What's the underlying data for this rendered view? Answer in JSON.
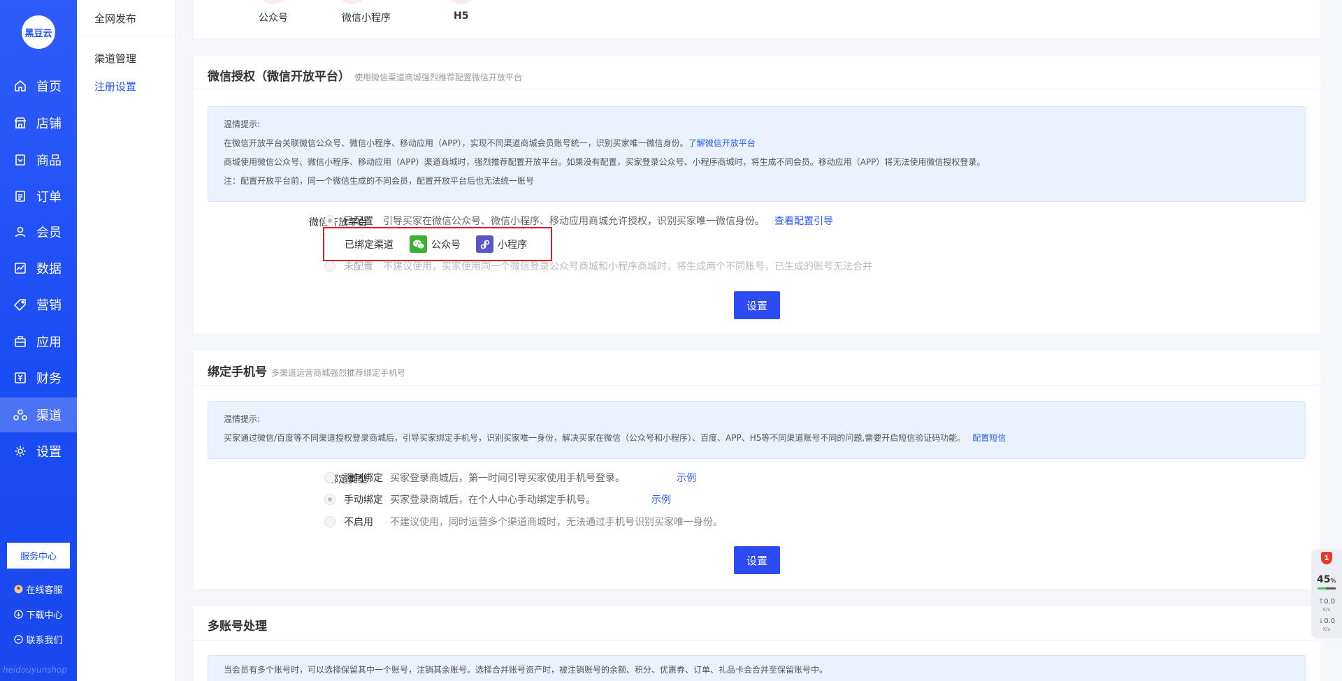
{
  "app": {
    "logo_text": "黑豆云",
    "watermark": "heidouyunshop"
  },
  "nav": {
    "items": [
      {
        "label": "首页",
        "icon": "home-icon"
      },
      {
        "label": "店铺",
        "icon": "store-icon"
      },
      {
        "label": "商品",
        "icon": "goods-icon"
      },
      {
        "label": "订单",
        "icon": "order-icon"
      },
      {
        "label": "会员",
        "icon": "member-icon"
      },
      {
        "label": "数据",
        "icon": "chart-icon"
      },
      {
        "label": "营销",
        "icon": "tag-icon"
      },
      {
        "label": "应用",
        "icon": "app-box-icon"
      },
      {
        "label": "财务",
        "icon": "finance-icon"
      },
      {
        "label": "渠道",
        "icon": "channel-icon"
      },
      {
        "label": "设置",
        "icon": "gear-icon"
      }
    ],
    "active": "渠道",
    "service_center": "服务中心",
    "links": [
      {
        "label": "在线客服",
        "icon": "avatar-icon"
      },
      {
        "label": "下载中心",
        "icon": "download-icon"
      },
      {
        "label": "联系我们",
        "icon": "chat-icon"
      }
    ]
  },
  "subnav": {
    "top": "全网发布",
    "items": [
      "渠道管理",
      "注册设置"
    ],
    "active": "注册设置"
  },
  "channels_strip": [
    "公众号",
    "微信小程序",
    "H5"
  ],
  "wechat_auth": {
    "title": "微信授权（微信开放平台）",
    "subtitle": "使用微信渠道商城强烈推荐配置微信开放平台",
    "tip": {
      "heading": "温情提示:",
      "line1": "在微信开放平台关联微信公众号、微信小程序、移动应用（APP），实现不同渠道商城会员账号统一，识别买家唯一微信身份。",
      "line1_link": "了解微信开放平台",
      "line2": "商城使用微信公众号、微信小程序、移动应用（APP）渠道商城时，强烈推荐配置开放平台。如果没有配置，买家登录公众号、小程序商城时，将生成不同会员。移动应用（APP）将无法使用微信授权登录。",
      "line3": "注：配置开放平台前，同一个微信生成的不同会员，配置开放平台后也无法统一账号"
    },
    "field_label": "微信开放平台",
    "options": [
      {
        "label": "已配置",
        "desc": "引导买家在微信公众号、微信小程序、移动应用商城允许授权，识别买家唯一微信身份。",
        "link": "查看配置引导",
        "checked": true
      },
      {
        "label": "未配置",
        "desc": "不建议使用，买家使用同一个微信登录公众号商城和小程序商城时，将生成两个不同账号，已生成的账号无法合并",
        "checked": false
      }
    ],
    "bound_popup": {
      "label": "已绑定渠道",
      "chips": [
        {
          "name": "公众号",
          "icon": "wechat-icon",
          "color": "#3cb034"
        },
        {
          "name": "小程序",
          "icon": "miniprogram-icon",
          "color": "#5b55c6"
        }
      ]
    },
    "button": "设置"
  },
  "bind_phone": {
    "title": "绑定手机号",
    "subtitle": "多渠道运营商城强烈推荐绑定手机号",
    "tip": {
      "heading": "温情提示:",
      "line1": "买家通过微信/百度等不同渠道授权登录商城后，引导买家绑定手机号，识别买家唯一身份，解决买家在微信（公众号和小程序）、百度、APP、H5等不同渠道账号不同的问题,需要开启短信验证码功能。",
      "line1_link": "配置短信"
    },
    "field_label": "绑定类型",
    "options": [
      {
        "label": "强制绑定",
        "desc": "买家登录商城后，第一时间引导买家使用手机号登录。",
        "link": "示例",
        "checked": false
      },
      {
        "label": "手动绑定",
        "desc": "买家登录商城后，在个人中心手动绑定手机号。",
        "link": "示例",
        "checked": true
      },
      {
        "label": "不启用",
        "desc": "不建议使用，同时运营多个渠道商城时，无法通过手机号识别买家唯一身份。",
        "checked": false
      }
    ],
    "button": "设置"
  },
  "multi_account": {
    "title": "多账号处理",
    "tip_line": "当会员有多个账号时，可以选择保留其中一个账号，注销其余账号。选择合并账号资产时，被注销账号的余额、积分、优惠券、订单、礼品卡会合并至保留账号中。"
  },
  "widget": {
    "badge": "1",
    "percent": "45",
    "percent_sign": "%",
    "percent_fraction": 0.45,
    "up_speed": "0.0",
    "down_speed": "0.0",
    "speed_unit": "K/s"
  }
}
